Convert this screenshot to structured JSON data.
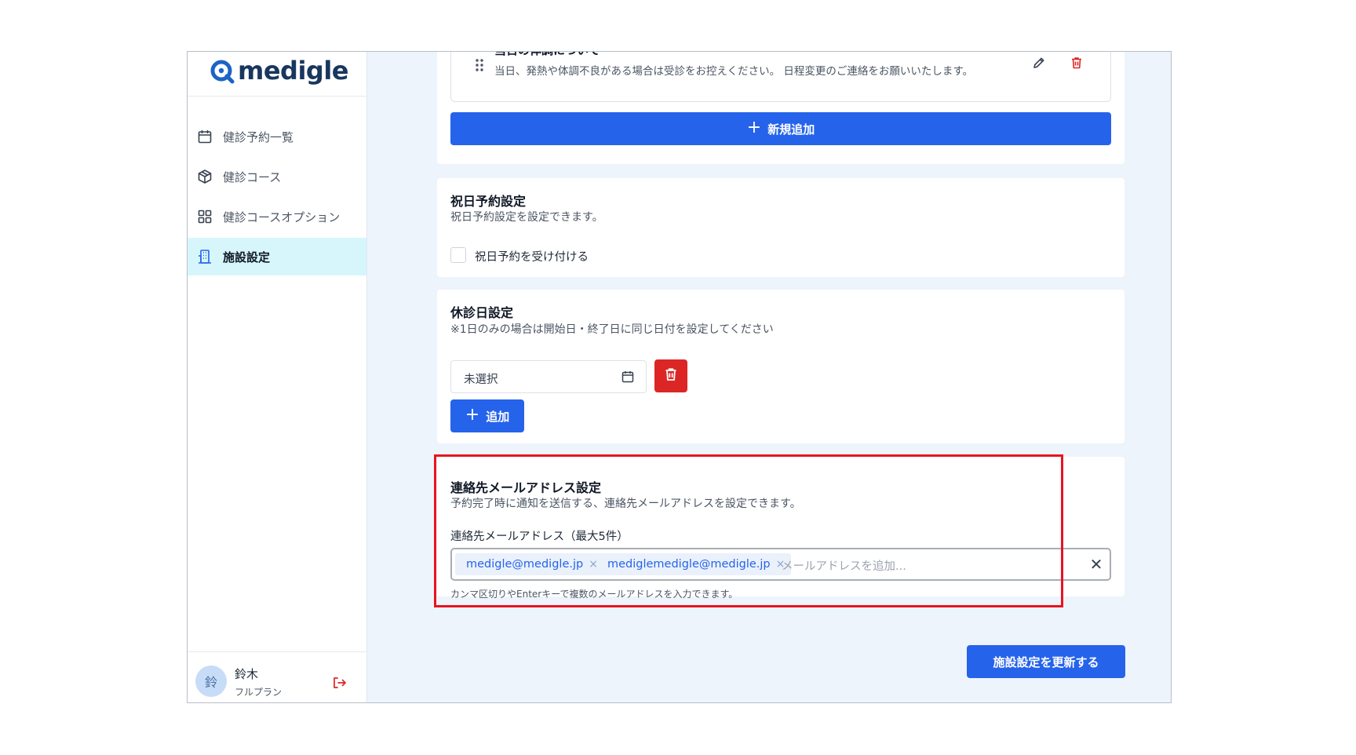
{
  "app": {
    "logo_text": "medigle"
  },
  "sidebar": {
    "items": [
      {
        "label": "健診予約一覧",
        "icon": "calendar-icon"
      },
      {
        "label": "健診コース",
        "icon": "box-icon"
      },
      {
        "label": "健診コースオプション",
        "icon": "grid-icon"
      },
      {
        "label": "施設設定",
        "icon": "building-icon",
        "active": true
      }
    ],
    "user": {
      "avatar": "鈴",
      "name": "鈴木",
      "plan": "フルプラン"
    }
  },
  "notice_item": {
    "title": "当日の体調について",
    "description": "当日、発熱や体調不良がある場合は受診をお控えください。 日程変更のご連絡をお願いいたします。"
  },
  "new_add_button": "新規追加",
  "holiday": {
    "title": "祝日予約設定",
    "subtitle": "祝日予約設定を設定できます。",
    "checkbox_label": "祝日予約を受け付ける",
    "checked": false
  },
  "closed_days": {
    "title": "休診日設定",
    "subtitle": "※1日のみの場合は開始日・終了日に同じ日付を設定してください",
    "date_value": "未選択",
    "add_button": "追加"
  },
  "email": {
    "title": "連絡先メールアドレス設定",
    "subtitle": "予約完了時に通知を送信する、連絡先メールアドレスを設定できます。",
    "field_label": "連絡先メールアドレス（最大5件）",
    "chips": [
      "medigle@medigle.jp",
      "mediglemedigle@medigle.jp"
    ],
    "chip_remove": "×",
    "placeholder": "メールアドレスを追加...",
    "clear": "✕",
    "help": "カンマ区切りやEnterキーで複数のメールアドレスを入力できます。"
  },
  "update_button": "施設設定を更新する",
  "colors": {
    "primary": "#2563eb",
    "danger": "#dc2626",
    "highlight": "#e8141f",
    "active_nav": "#d6f6fc"
  }
}
